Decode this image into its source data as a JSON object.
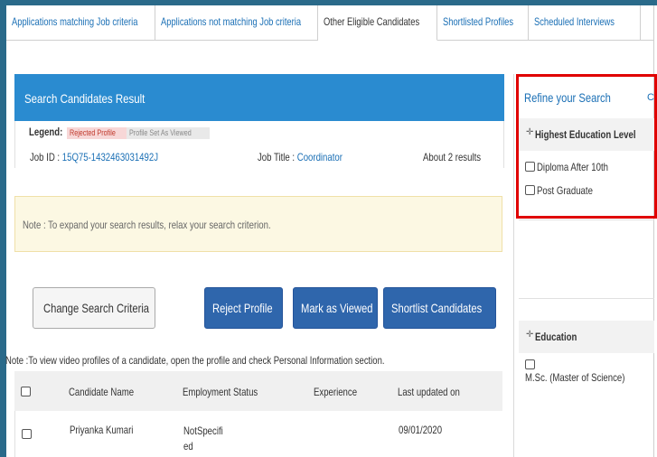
{
  "tabs": [
    {
      "label": "Applications matching Job criteria"
    },
    {
      "label": "Applications not matching Job criteria"
    },
    {
      "label": "Other Eligible Candidates"
    },
    {
      "label": "Shortlisted Profiles"
    },
    {
      "label": "Scheduled Interviews"
    }
  ],
  "active_tab": "Other Eligible Candidates",
  "results": {
    "header": "Search Candidates Result",
    "legend_label": "Legend:",
    "legend_rejected": "Rejected Profile",
    "legend_viewed": "Profile Set As Viewed",
    "job_id_label": "Job ID :",
    "job_id": "15Q75-1432463031492J",
    "job_title_label": "Job Title :",
    "job_title": "Coordinator",
    "count": "About 2 results",
    "note": "Note : To expand your search results, relax your search criterion."
  },
  "buttons": {
    "change": "Change Search Criteria",
    "reject": "Reject Profile",
    "viewed": "Mark as Viewed",
    "shortlist": "Shortlist Candidates"
  },
  "video_note": "Note :To view video profiles of a candidate, open the profile and check Personal Information section.",
  "table": {
    "headers": [
      "Candidate Name",
      "Employment Status",
      "Experience",
      "Last updated on"
    ],
    "rows": [
      {
        "name": "Priyanka Kumari",
        "status_line1": "NotSpecifi",
        "status_line2": "ed",
        "experience": "",
        "updated": "09/01/2020"
      }
    ]
  },
  "refine": {
    "title": "Refine your Search",
    "clear": "Cl",
    "sections": [
      {
        "title": "Highest Education Level",
        "options": [
          "Diploma After 10th",
          "Post Graduate"
        ]
      },
      {
        "title": "Education",
        "options": [
          "M.Sc. (Master of Science)"
        ]
      }
    ]
  },
  "colors": {
    "header_blue": "#2a8bd0",
    "button_blue": "#2f66ac",
    "highlight_red": "#e00000",
    "note_bg": "#fcf8e3"
  }
}
